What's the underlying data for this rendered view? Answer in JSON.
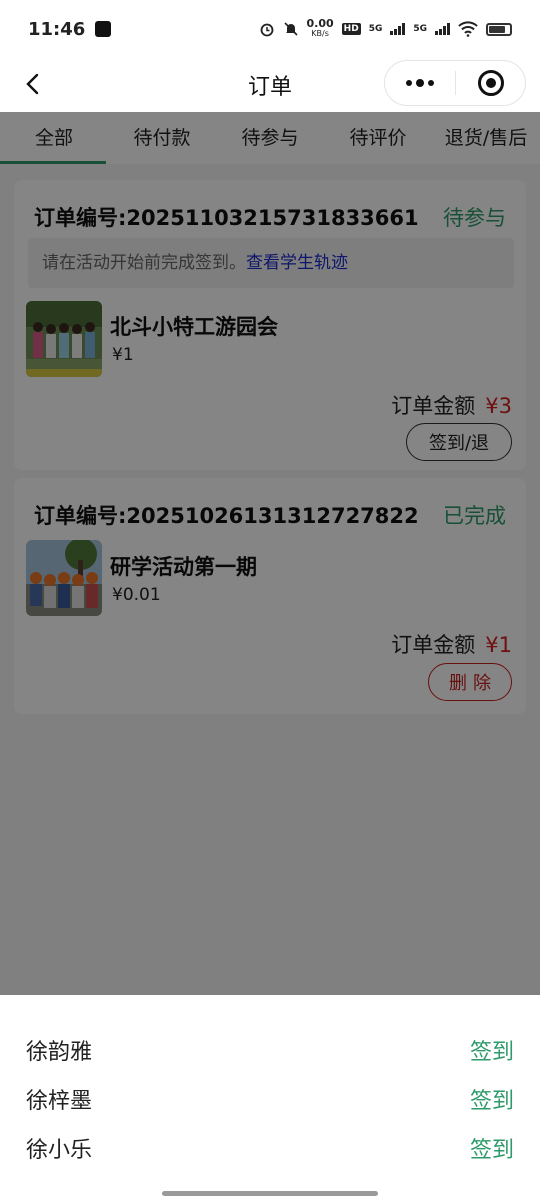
{
  "status_bar": {
    "time": "11:46",
    "net_speed": "0.00",
    "net_unit": "KB/s",
    "hd": "HD",
    "net1": "5G",
    "net2": "5G"
  },
  "nav": {
    "back_icon": "chevron-left-icon",
    "title": "订单",
    "more_icon": "more-dots-icon",
    "target_icon": "target-icon"
  },
  "tabs": [
    {
      "label": "全部",
      "active": true
    },
    {
      "label": "待付款",
      "active": false
    },
    {
      "label": "待参与",
      "active": false
    },
    {
      "label": "待评价",
      "active": false
    },
    {
      "label": "退货/售后",
      "active": false
    }
  ],
  "orders": [
    {
      "order_no": "订单编号:20251103215731833661",
      "status": "待参与",
      "notice_text": "请在活动开始前完成签到。",
      "notice_link": "查看学生轨迹",
      "item_name": "北斗小特工游园会",
      "item_price": "¥1",
      "amount_label": "订单金额",
      "amount_value": "¥3",
      "action": "签到/退"
    },
    {
      "order_no": "订单编号:20251026131312727822",
      "status": "已完成",
      "item_name": "研学活动第一期",
      "item_price": "¥0.01",
      "amount_label": "订单金额",
      "amount_value": "¥1",
      "action": "删除"
    }
  ],
  "students": [
    {
      "name": "徐韵雅",
      "action": "签到"
    },
    {
      "name": "徐梓墨",
      "action": "签到"
    },
    {
      "name": "徐小乐",
      "action": "签到"
    }
  ],
  "colors": {
    "accent_green": "#2e9a6a",
    "price_red": "#d42020",
    "link_blue": "#1b2ccc"
  }
}
